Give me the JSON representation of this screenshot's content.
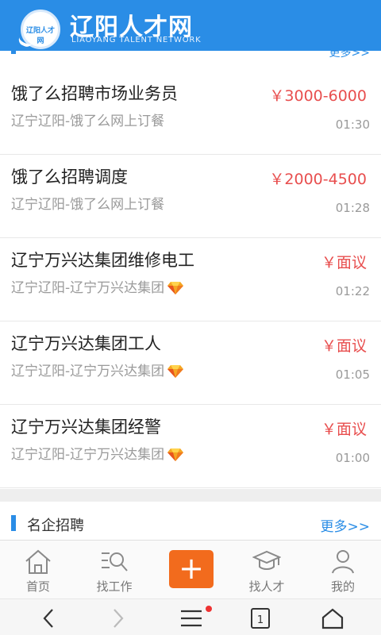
{
  "header": {
    "logo_text": "辽阳人才网",
    "brand": "辽阳人才网",
    "brand_sub": "LIAOYANG TALENT NETWORK"
  },
  "prev_section": {
    "more": "更多>>"
  },
  "jobs": [
    {
      "title": "饿了么招聘市场业务员",
      "salary": "￥3000-6000",
      "company": "辽宁辽阳-饿了么网上订餐",
      "time": "01:30",
      "gem": false
    },
    {
      "title": "饿了么招聘调度",
      "salary": "￥2000-4500",
      "company": "辽宁辽阳-饿了么网上订餐",
      "time": "01:28",
      "gem": false
    },
    {
      "title": "辽宁万兴达集团维修电工",
      "salary": "￥面议",
      "company": "辽宁辽阳-辽宁万兴达集团",
      "time": "01:22",
      "gem": true
    },
    {
      "title": "辽宁万兴达集团工人",
      "salary": "￥面议",
      "company": "辽宁辽阳-辽宁万兴达集团",
      "time": "01:05",
      "gem": true
    },
    {
      "title": "辽宁万兴达集团经警",
      "salary": "￥面议",
      "company": "辽宁辽阳-辽宁万兴达集团",
      "time": "01:00",
      "gem": true
    }
  ],
  "section": {
    "title": "名企招聘",
    "more": "更多>>"
  },
  "tabs": {
    "home": "首页",
    "find_job": "找工作",
    "plus": "+",
    "find_talent": "找人才",
    "mine": "我的"
  },
  "browser_nav": {
    "tab_count": "1"
  },
  "colors": {
    "brand_blue": "#2a8de6",
    "salary_red": "#e84e4e",
    "plus_orange": "#f26b1d"
  }
}
